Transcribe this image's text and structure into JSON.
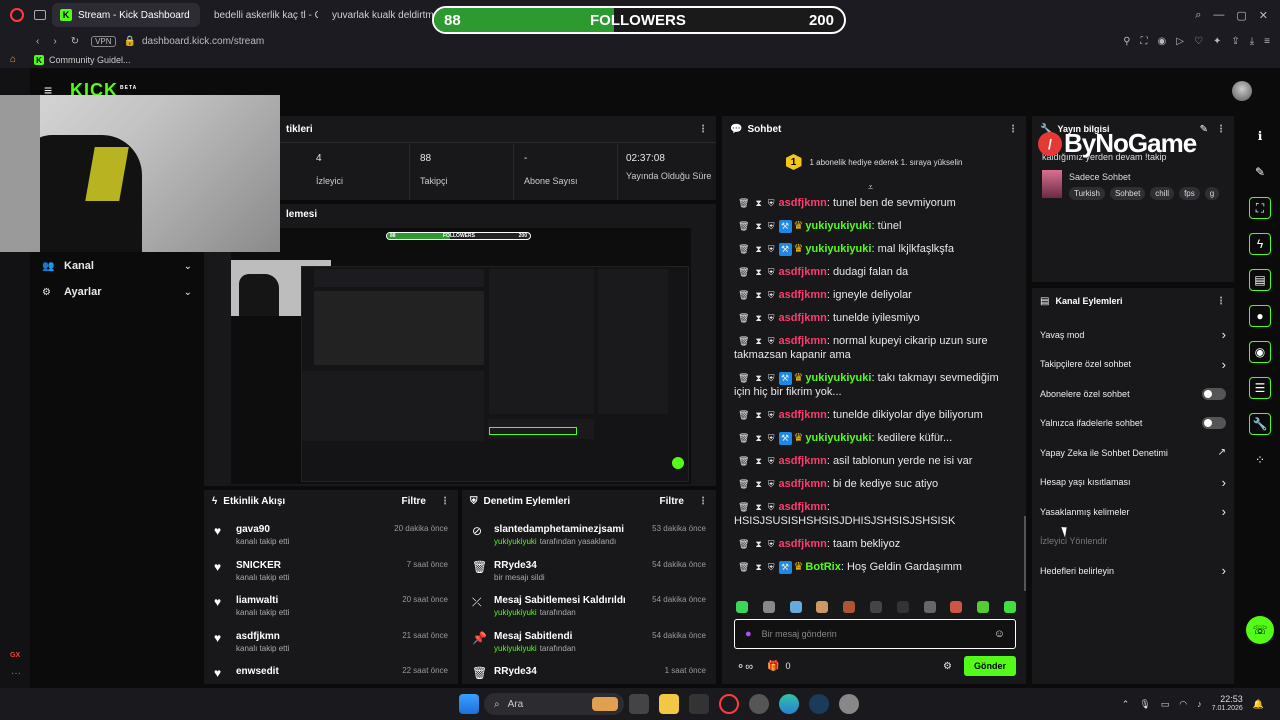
{
  "browser": {
    "tabs": [
      {
        "label": "Stream - Kick Dashboard",
        "active": true
      },
      {
        "label": "bedelli askerlik kaç tl - Go",
        "active": false
      },
      {
        "label": "yuvarlak kualk deldirtme",
        "active": false
      }
    ],
    "vpn": "VPN",
    "url": "dashboard.kick.com/stream",
    "bookmark": "Community Guidel..."
  },
  "overlay": {
    "followers_current": "88",
    "followers_label": "FOLLOWERS",
    "followers_goal": "200",
    "followers_progress": 0.44,
    "brand": "ByNoGame"
  },
  "kick": {
    "logo": "KICK",
    "beta": "BETA"
  },
  "sidebar": {
    "items": [
      {
        "label": "Kanal"
      },
      {
        "label": "Ayarlar"
      }
    ]
  },
  "stats": {
    "title": "tikleri",
    "items": [
      {
        "value": "4",
        "label": "İzleyici"
      },
      {
        "value": "88",
        "label": "Takipçi"
      },
      {
        "value": "-",
        "label": "Abone Sayısı"
      },
      {
        "value": "02:37:08",
        "label": "Yayında Olduğu Süre"
      }
    ]
  },
  "preview": {
    "title": "lemesi",
    "thumb_followers_current": "88",
    "thumb_followers_label": "FOLLOWERS",
    "thumb_followers_goal": "200"
  },
  "activity": {
    "title": "Etkinlik Akışı",
    "filter": "Filtre",
    "items": [
      {
        "name": "gava90",
        "sub": "kanalı takip etti",
        "time": "20 dakika önce"
      },
      {
        "name": "SNICKER",
        "sub": "kanalı takip etti",
        "time": "7 saat önce"
      },
      {
        "name": "liamwalti",
        "sub": "kanalı takip etti",
        "time": "20 saat önce"
      },
      {
        "name": "asdfjkmn",
        "sub": "kanalı takip etti",
        "time": "21 saat önce"
      },
      {
        "name": "enwsedit",
        "sub": "",
        "time": "22 saat önce"
      }
    ]
  },
  "moderation": {
    "title": "Denetim Eylemleri",
    "filter": "Filtre",
    "items": [
      {
        "icon": "ban-icon",
        "name": "slantedamphetaminezjsami",
        "by": "yukiyukiyuki",
        "sub": "tarafından yasaklandı",
        "time": "53 dakika önce"
      },
      {
        "icon": "trash-icon",
        "name": "RRyde34",
        "by": "",
        "sub": "bir mesajı sildi",
        "time": "54 dakika önce"
      },
      {
        "icon": "unpin-icon",
        "name": "Mesaj Sabitlemesi Kaldırıldı",
        "by": "yukiyukiyuki",
        "sub": "tarafından",
        "time": "54 dakika önce"
      },
      {
        "icon": "pin-icon",
        "name": "Mesaj Sabitlendi",
        "by": "yukiyukiyuki",
        "sub": "tarafından",
        "time": "54 dakika önce"
      },
      {
        "icon": "trash-icon",
        "name": "RRyde34",
        "by": "",
        "sub": "",
        "time": "1 saat önce"
      }
    ]
  },
  "chat": {
    "title": "Sohbet",
    "goal_badge": "1",
    "goal_text": "1 abonelik hediye ederek 1. sıraya yükselin",
    "input_placeholder": "Bir mesaj gönderin",
    "count": "0",
    "send": "Gönder",
    "colors": {
      "asdf": "#ff3b6b",
      "yuki": "#53fc18"
    },
    "messages": [
      {
        "user": "asdfjkmn",
        "color": "#ff3b6b",
        "badges": false,
        "text": ": tunel ben de sevmiyorum"
      },
      {
        "user": "yukiyukiyuki",
        "color": "#53fc18",
        "badges": true,
        "text": ": tünel"
      },
      {
        "user": "yukiyukiyuki",
        "color": "#53fc18",
        "badges": true,
        "text": ": mal lkjlkfaşlkşfa"
      },
      {
        "user": "asdfjkmn",
        "color": "#ff3b6b",
        "badges": false,
        "text": ": dudagi falan da"
      },
      {
        "user": "asdfjkmn",
        "color": "#ff3b6b",
        "badges": false,
        "text": ": igneyle deliyolar"
      },
      {
        "user": "asdfjkmn",
        "color": "#ff3b6b",
        "badges": false,
        "text": ": tunelde iyilesmiyo"
      },
      {
        "user": "asdfjkmn",
        "color": "#ff3b6b",
        "badges": false,
        "text": ": normal kupeyi cikarip uzun sure takmazsan kapanir ama"
      },
      {
        "user": "yukiyukiyuki",
        "color": "#53fc18",
        "badges": true,
        "text": ": takı takmayı sevmediğim için hiç bir fikrim yok..."
      },
      {
        "user": "asdfjkmn",
        "color": "#ff3b6b",
        "badges": false,
        "text": ": tunelde dikiyolar diye biliyorum"
      },
      {
        "user": "yukiyukiyuki",
        "color": "#53fc18",
        "badges": true,
        "text": ": kedilere küfür..."
      },
      {
        "user": "asdfjkmn",
        "color": "#ff3b6b",
        "badges": false,
        "text": ": asil tablonun yerde ne isi var"
      },
      {
        "user": "asdfjkmn",
        "color": "#ff3b6b",
        "badges": false,
        "text": ": bi de kediye suc atiyo"
      },
      {
        "user": "asdfjkmn",
        "color": "#ff3b6b",
        "badges": false,
        "text": ": HSISJSUSISHSHSISJDHISJSHSISJSHSISK"
      },
      {
        "user": "asdfjkmn",
        "color": "#ff3b6b",
        "badges": false,
        "text": ": taam bekliyoz"
      },
      {
        "user": "BotRix",
        "color": "#53fc18",
        "badges": true,
        "text": ": Hoş Geldin Gardaşımm"
      }
    ]
  },
  "stream_info": {
    "title": "Yayın bilgisi",
    "stream_title": "kaldığımız yerden devam !takip",
    "category": "Sadece Sohbet",
    "tags": [
      "Turkish",
      "Sohbet",
      "chill",
      "fps",
      "g"
    ]
  },
  "channel_actions": {
    "title": "Kanal Eylemleri",
    "items": [
      {
        "label": "Yavaş mod",
        "control": "arrow"
      },
      {
        "label": "Takipçilere özel sohbet",
        "control": "arrow"
      },
      {
        "label": "Abonelere özel sohbet",
        "control": "toggle"
      },
      {
        "label": "Yalnızca ifadelerle sohbet",
        "control": "toggle"
      },
      {
        "label": "Yapay Zeka ile Sohbet Denetimi",
        "control": "external"
      },
      {
        "label": "Hesap yaşı kısıtlaması",
        "control": "arrow"
      },
      {
        "label": "Yasaklanmış kelimeler",
        "control": "arrow"
      },
      {
        "label": "İzleyici Yönlendir",
        "control": "none"
      },
      {
        "label": "Hedefleri belirleyin",
        "control": "arrow"
      }
    ]
  },
  "taskbar": {
    "search": "Ara",
    "time": "22:53",
    "date": "7.01.2026"
  }
}
